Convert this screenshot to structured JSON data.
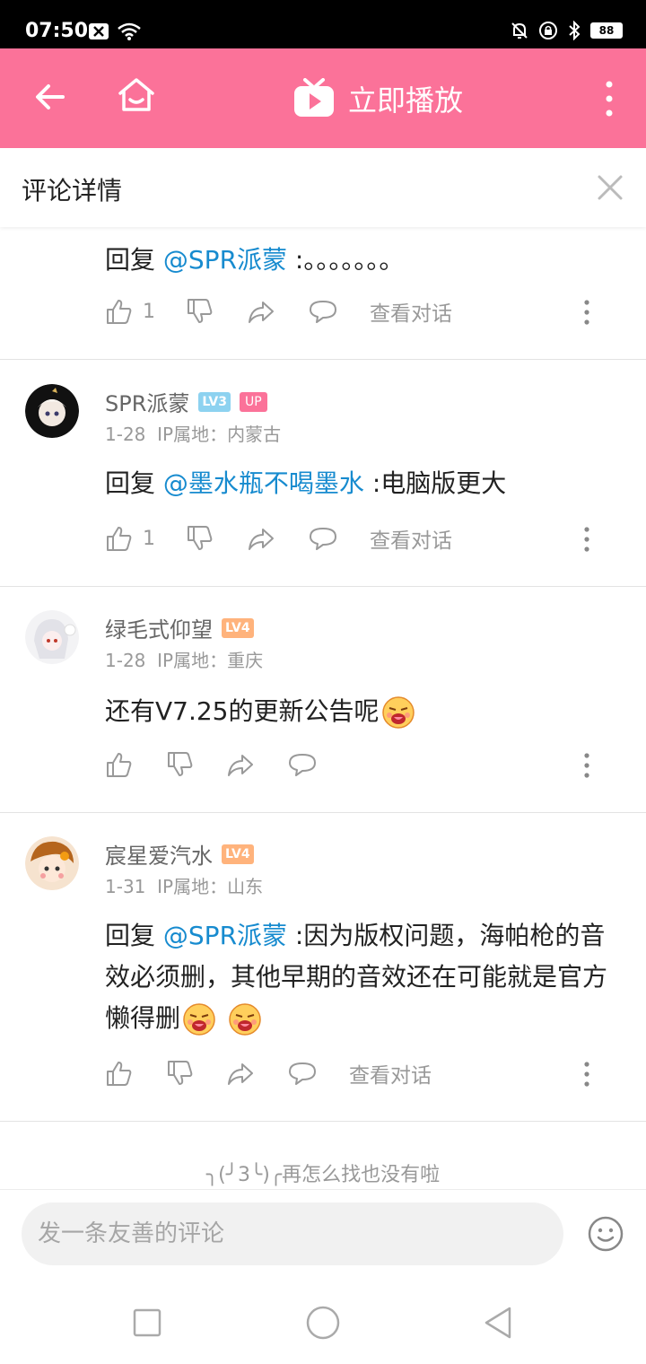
{
  "status_bar": {
    "time": "07:50",
    "battery": "88",
    "icons": [
      "x-box-icon",
      "wifi-icon",
      "bell-off-icon",
      "lock-rotation-icon",
      "bluetooth-icon",
      "battery-icon"
    ]
  },
  "topbar": {
    "play_label": "立即播放",
    "accent_color": "#fb7299"
  },
  "subheader": {
    "title": "评论详情"
  },
  "partial_comment": {
    "reply_prefix": "回复 ",
    "mention": "@SPR派蒙",
    "text": " :。。。。。。。",
    "likes": "1",
    "view_conversation": "查看对话"
  },
  "comments": [
    {
      "username": "SPR派蒙",
      "level": "LV3",
      "up_badge": "UP",
      "date": "1-28",
      "ip_label": "IP属地：内蒙古",
      "reply_prefix": "回复 ",
      "mention": "@墨水瓶不喝墨水",
      "text": " :电脑版更大",
      "likes": "1",
      "view_conversation": "查看对话"
    },
    {
      "username": "绿毛式仰望",
      "level": "LV4",
      "date": "1-28",
      "ip_label": "IP属地：重庆",
      "text": "还有V7.25的更新公告呢"
    },
    {
      "username": "宸星爱汽水",
      "level": "LV4",
      "date": "1-31",
      "ip_label": "IP属地：山东",
      "reply_prefix": "回复 ",
      "mention": "@SPR派蒙",
      "text": " :因为版权问题，海帕枪的音效必须删，其他早期的音效还在可能就是官方懒得删",
      "view_conversation": "查看对话"
    }
  ],
  "end_message": "╮(╯3╰)╭再怎么找也没有啦",
  "input": {
    "placeholder": "发一条友善的评论"
  }
}
